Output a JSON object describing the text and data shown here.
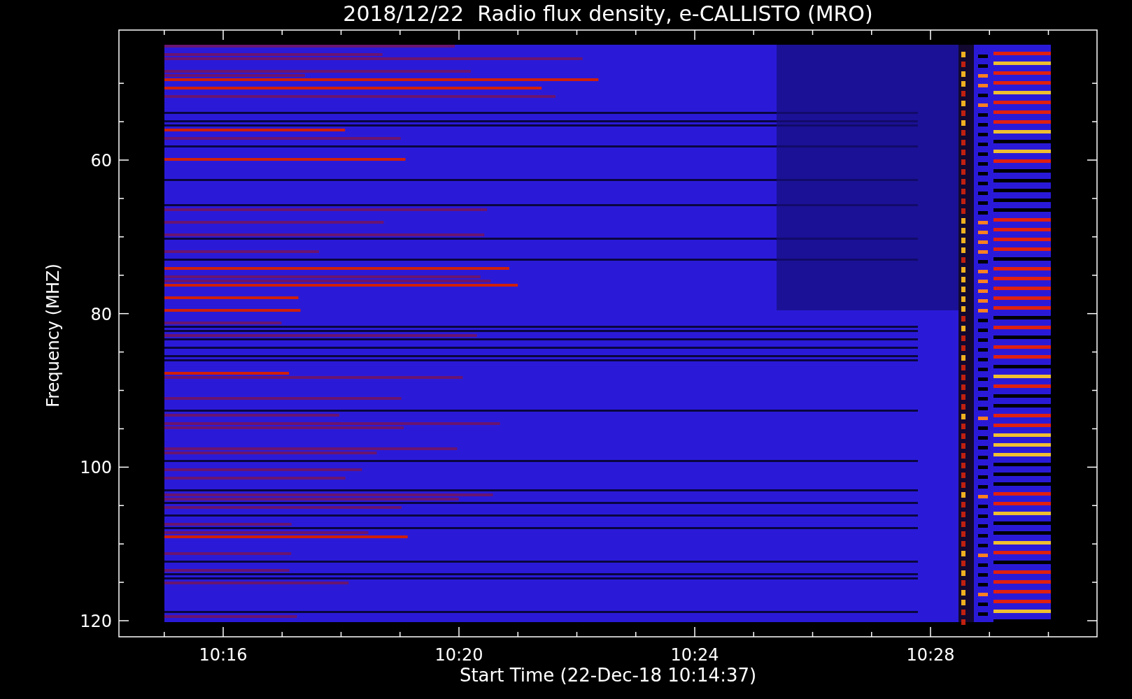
{
  "title": "2018/12/22  Radio flux density, e-CALLISTO (MRO)",
  "ylabel": "Frequency (MHZ)",
  "xlabel": "Start Time (22-Dec-18 10:14:37)",
  "yticks": [
    "60",
    "80",
    "100",
    "120"
  ],
  "xticks": [
    "10:16",
    "10:20",
    "10:24",
    "10:28"
  ]
}
